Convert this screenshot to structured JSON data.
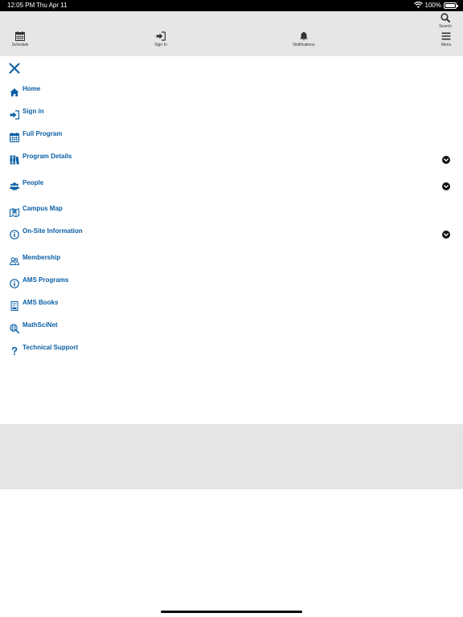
{
  "status_bar": {
    "time": "12:05 PM",
    "date": "Thu Apr 11",
    "battery": "100%"
  },
  "toolbar": {
    "schedule": "Schedule",
    "signin": "Sign In",
    "notifications": "Notifications",
    "search": "Search",
    "menu": "Menu"
  },
  "colors": {
    "accent": "#0b5fa5",
    "toolbar_bg": "#e6e6e6",
    "band_bg": "#e5e5e5"
  },
  "menu": {
    "items": [
      {
        "label": "Home",
        "icon": "home-icon"
      },
      {
        "label": "Sign in",
        "icon": "sign-in-icon"
      },
      {
        "label": "Full Program",
        "icon": "calendar-icon"
      },
      {
        "label": "Program Details",
        "icon": "books-icon",
        "expandable": true
      },
      {
        "label": "People",
        "icon": "people-icon",
        "expandable": true
      },
      {
        "label": "Campus Map",
        "icon": "map-icon"
      },
      {
        "label": "On-Site Information",
        "icon": "info-icon",
        "expandable": true
      },
      {
        "label": "Membership",
        "icon": "membership-icon"
      },
      {
        "label": "AMS Programs",
        "icon": "info-icon"
      },
      {
        "label": "AMS Books",
        "icon": "book-icon"
      },
      {
        "label": "MathSciNet",
        "icon": "globe-search-icon"
      },
      {
        "label": "Technical Support",
        "icon": "question-icon"
      }
    ]
  }
}
